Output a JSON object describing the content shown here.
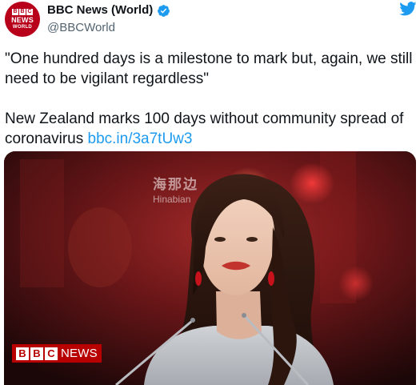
{
  "account": {
    "display_name": "BBC News (World)",
    "handle": "@BBCWorld",
    "avatar": {
      "brand_letters": [
        "B",
        "B",
        "C"
      ],
      "line1": "NEWS",
      "line2": "WORLD"
    },
    "verified_icon": "verified-badge-icon"
  },
  "platform_icon": "twitter-bird-icon",
  "tweet": {
    "quote_text": "\"One hundred days is a milestone to mark but, again, we still need to be vigilant regardless\"",
    "body_text": "New Zealand marks 100 days without community spread of coronavirus ",
    "link_text": "bbc.in/3a7tUw3"
  },
  "media": {
    "watermark_cn": "海那边",
    "watermark_en": "Hinabian",
    "bug_letters": [
      "B",
      "B",
      "C"
    ],
    "bug_word": "NEWS"
  },
  "colors": {
    "brand_red": "#b8001b",
    "link_blue": "#1d9bf0",
    "text": "#0f1419",
    "muted": "#536471"
  }
}
